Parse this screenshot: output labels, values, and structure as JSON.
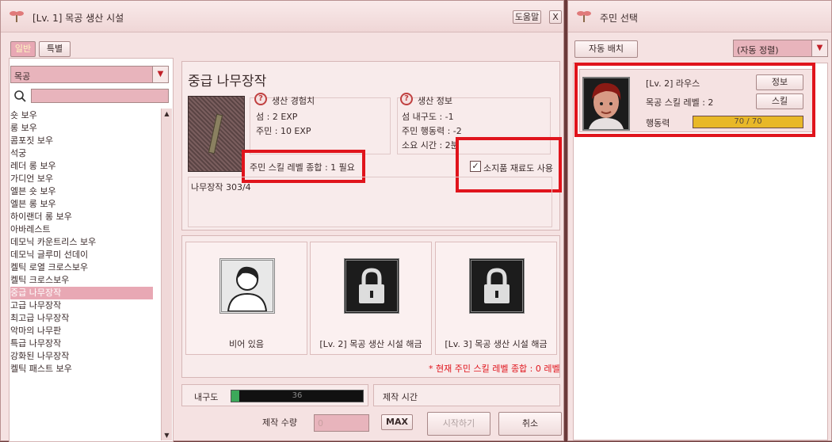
{
  "main_window": {
    "title": "[Lv. 1] 목공 생산 시설",
    "help_label": "도움말",
    "close_label": "X"
  },
  "tabs": [
    {
      "label": "일반"
    },
    {
      "label": "특별"
    }
  ],
  "category_select": {
    "value": "목공"
  },
  "search": {
    "placeholder": ""
  },
  "recipe_list": [
    "숏 보우",
    "롱 보우",
    "콤포짓 보우",
    "석궁",
    "레더 롱 보우",
    "가디언 보우",
    "엘븐 숏 보우",
    "엘븐 롱 보우",
    "하이랜더 롱 보우",
    "아바레스트",
    "데모닉 카운트리스 보우",
    "데모닉 글루미 선데이",
    "켈틱 로열 크로스보우",
    "켈틱 크로스보우",
    "중급 나무장작",
    "고급 나무장작",
    "최고급 나무장작",
    "악마의 나무판",
    "특급 나무장작",
    "강화된 나무장작",
    "켈틱 패스트 보우"
  ],
  "selected_index": 14,
  "detail": {
    "item_name": "중급 나무장작",
    "exp_header": "생산 경험치",
    "exp_island": "섬 : 2 EXP",
    "exp_resident": "주민 : 10 EXP",
    "info_header": "생산 정보",
    "info_durability": "섬 내구도 : -1",
    "info_action": "주민 행동력 : -2",
    "info_time": "소요 시간 : 2분",
    "skill_req": "주민 스킬 레벨 종합 : 1 필요",
    "use_inventory_label": "소지품 재료도 사용",
    "material": "나무장작 303/4"
  },
  "slots": [
    {
      "caption": "비어 있음",
      "icon": "person-silhouette-icon"
    },
    {
      "caption": "[Lv. 2] 목공 생산 시설 해금",
      "icon": "lock-icon"
    },
    {
      "caption": "[Lv. 3] 목공 생산 시설 해금",
      "icon": "lock-icon"
    }
  ],
  "current_skill_note": "* 현재 주민 스킬 레벨 종합 : 0 레벨",
  "durability": {
    "label": "내구도",
    "value": "36",
    "fraction": 0.06
  },
  "craft_time_label": "제작 시간",
  "quantity": {
    "label": "제작 수량",
    "value": "0",
    "max_label": "MAX"
  },
  "start_label": "시작하기",
  "cancel_label": "취소",
  "resident_window": {
    "title": "주민 선택",
    "auto_assign_label": "자동 배치",
    "sort_value": "(자동 정렬)",
    "resident": {
      "name_line": "[Lv. 2]  라우스",
      "skill_line": "목공 스킬 레벨 : 2",
      "action_label": "행동력",
      "action_value": "70 / 70",
      "action_fraction": 1.0,
      "info_label": "정보",
      "skill_label": "스킬"
    }
  },
  "colors": {
    "accent_red": "#e0141c",
    "bar_gold": "#e8b828",
    "bar_green": "#3ca85a"
  }
}
